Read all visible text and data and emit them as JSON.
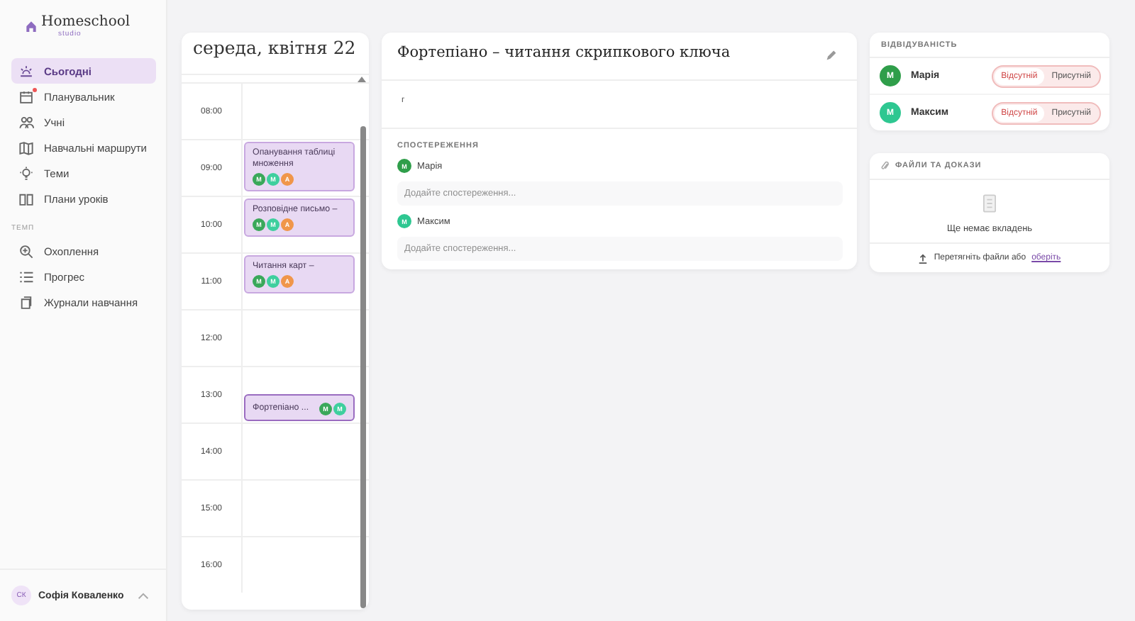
{
  "brand": {
    "name": "Homeschool",
    "sub": "studio"
  },
  "nav": [
    {
      "label": "Сьогодні",
      "selected": true,
      "badge": false
    },
    {
      "label": "Планувальник",
      "selected": false,
      "badge": true
    },
    {
      "label": "Учні",
      "selected": false,
      "badge": false
    },
    {
      "label": "Навчальні маршрути",
      "selected": false,
      "badge": false
    },
    {
      "label": "Теми",
      "selected": false,
      "badge": false
    },
    {
      "label": "Плани уроків",
      "selected": false,
      "badge": false
    }
  ],
  "section_label": "ТЕМП",
  "nav2": [
    {
      "label": "Охоплення",
      "selected": false,
      "badge": false
    },
    {
      "label": "Прогрес",
      "selected": false,
      "badge": false
    },
    {
      "label": "Журнали навчання",
      "selected": false,
      "badge": false
    }
  ],
  "user": {
    "initials": "СК",
    "name": "Софія Коваленко"
  },
  "calendar": {
    "title": "середа, квітня 22",
    "hours": [
      {
        "time": "08:00"
      },
      {
        "time": "09:00",
        "events": [
          {
            "title": "Опанування таблиці множення",
            "selected": false,
            "avatars": [
              {
                "letter": "М",
                "color": "#3aa85a"
              },
              {
                "letter": "М",
                "color": "#3ecf9e"
              },
              {
                "letter": "А",
                "color": "#f0964a"
              }
            ]
          }
        ]
      },
      {
        "time": "10:00",
        "events": [
          {
            "title": "Розповідне письмо –",
            "selected": false,
            "avatars": [
              {
                "letter": "М",
                "color": "#3aa85a"
              },
              {
                "letter": "М",
                "color": "#3ecf9e"
              },
              {
                "letter": "А",
                "color": "#f0964a"
              }
            ]
          }
        ]
      },
      {
        "time": "11:00",
        "events": [
          {
            "title": "Читання карт –",
            "selected": false,
            "avatars": [
              {
                "letter": "М",
                "color": "#3aa85a"
              },
              {
                "letter": "М",
                "color": "#3ecf9e"
              },
              {
                "letter": "А",
                "color": "#f0964a"
              }
            ]
          }
        ]
      },
      {
        "time": "12:00"
      },
      {
        "time": "13:00",
        "events": [
          {
            "title": "Фортепіано ...",
            "selected": true,
            "avatars": [
              {
                "letter": "М",
                "color": "#3aa85a"
              },
              {
                "letter": "М",
                "color": "#3ecf9e"
              }
            ]
          }
        ]
      },
      {
        "time": "14:00"
      },
      {
        "time": "15:00"
      },
      {
        "time": "16:00"
      }
    ]
  },
  "lesson": {
    "title": "Фортепіано – читання скрипкового ключа",
    "note": "г",
    "observations_label": "СПОСТЕРЕЖЕННЯ",
    "observations": [
      {
        "letter": "М",
        "color": "#2f9e4a",
        "name": "Марія",
        "placeholder": "Додайте спостереження..."
      },
      {
        "letter": "М",
        "color": "#2ec791",
        "name": "Максим",
        "placeholder": "Додайте спостереження..."
      }
    ]
  },
  "attendance": {
    "title": "ВІДВІДУВАНІСТЬ",
    "students": [
      {
        "letter": "М",
        "color": "#2f9e4a",
        "name": "Марія",
        "options": [
          {
            "label": "Відсутній",
            "selected": true
          },
          {
            "label": "Присутній",
            "selected": false
          }
        ]
      },
      {
        "letter": "М",
        "color": "#2ec791",
        "name": "Максим",
        "options": [
          {
            "label": "Відсутній",
            "selected": true
          },
          {
            "label": "Присутній",
            "selected": false
          }
        ]
      }
    ]
  },
  "files": {
    "title": "ФАЙЛИ ТА ДОКАЗИ",
    "empty": "Ще немає вкладень",
    "drop": "Перетягніть файли або",
    "link": "оберіть"
  }
}
